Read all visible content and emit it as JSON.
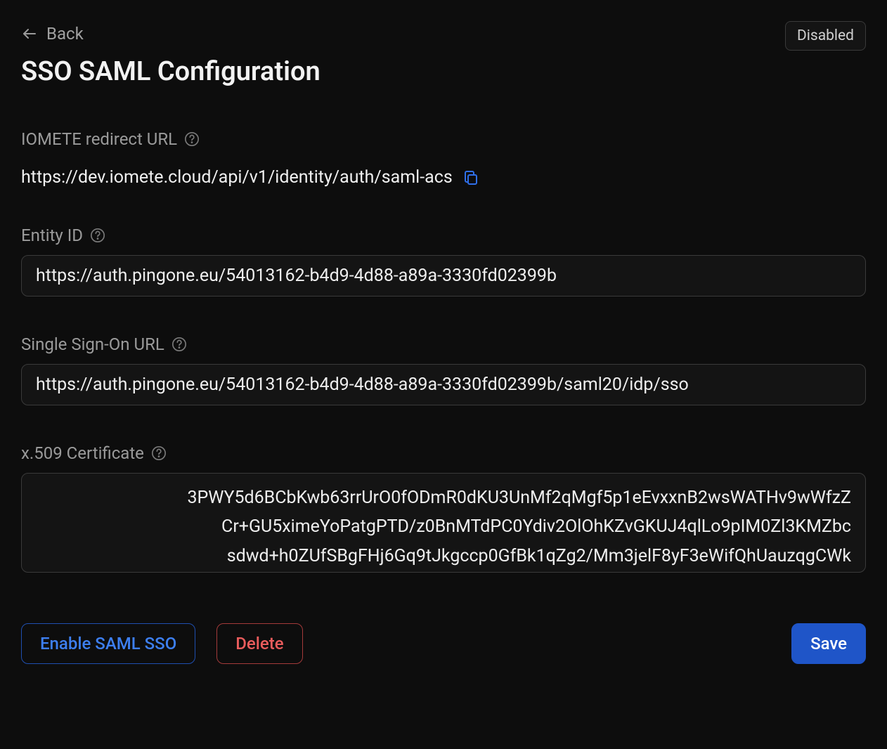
{
  "header": {
    "back_label": "Back",
    "title": "SSO SAML Configuration",
    "status_badge": "Disabled"
  },
  "redirect": {
    "label": "IOMETE redirect URL",
    "url": "https://dev.iomete.cloud/api/v1/identity/auth/saml-acs"
  },
  "entity_id": {
    "label": "Entity ID",
    "value": "https://auth.pingone.eu/54013162-b4d9-4d88-a89a-3330fd02399b"
  },
  "sso_url": {
    "label": "Single Sign-On URL",
    "value": "https://auth.pingone.eu/54013162-b4d9-4d88-a89a-3330fd02399b/saml20/idp/sso"
  },
  "certificate": {
    "label": "x.509 Certificate",
    "value": "3PWY5d6BCbKwb63rrUrO0fODmR0dKU3UnMf2qMgf5p1eEvxxnB2wsWATHv9wWfzZ\nCr+GU5ximeYoPatgPTD/z0BnMTdPC0Ydiv2OlOhKZvGKUJ4qlLo9pIM0Zl3KMZbc\nsdwd+h0ZUfSBgFHj6Gq9tJkgccp0GfBk1qZg2/Mm3jelF8yF3eWifQhUauzqgCWk"
  },
  "actions": {
    "enable_label": "Enable SAML SSO",
    "delete_label": "Delete",
    "save_label": "Save"
  }
}
